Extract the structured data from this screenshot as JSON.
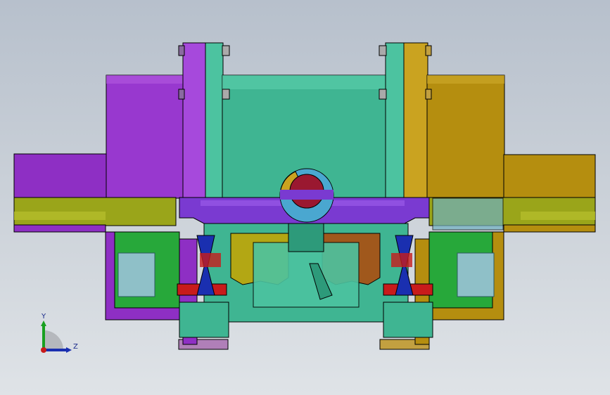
{
  "triad": {
    "y_label": "Y",
    "z_label": "Z"
  },
  "colors": {
    "background_top": "#b7c0cc",
    "purple": "#8e2fc4",
    "purple_light": "#a84fd8",
    "gold": "#b58e0f",
    "gold_light": "#caa320",
    "teal": "#3fb592",
    "teal_light": "#5bd1ad",
    "olive": "#9aa51a",
    "green": "#27a83a",
    "violet_bar": "#7a3ad1",
    "yellow_cup": "#b3a714",
    "brown_cup": "#a0581c",
    "red_plate": "#c81b1b",
    "dark_red_gear": "#9a1830",
    "spring": "#8fc0c8"
  }
}
